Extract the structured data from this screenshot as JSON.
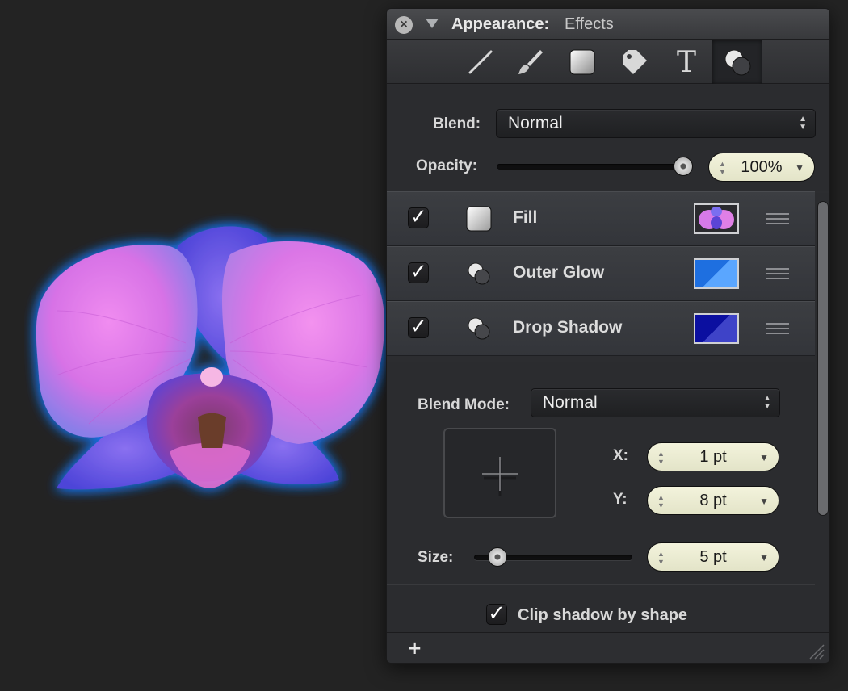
{
  "panel": {
    "title": "Appearance:",
    "subtitle": "Effects"
  },
  "toolbar": {
    "tools": [
      "line-tool-icon",
      "brush-tool-icon",
      "fill-tool-icon",
      "tag-tool-icon",
      "text-tool-icon",
      "effects-tool-icon"
    ],
    "text_glyph": "T",
    "active": "effects-tool-icon"
  },
  "blend": {
    "label": "Blend:",
    "value": "Normal"
  },
  "opacity": {
    "label": "Opacity:",
    "level": 1.0,
    "value": "100%"
  },
  "effects": [
    {
      "name": "Fill",
      "checked": true,
      "icon": "fill-square-icon",
      "swatch": "orchid-image-swatch"
    },
    {
      "name": "Outer Glow",
      "checked": true,
      "icon": "overlapping-circles-icon",
      "swatch_colors": [
        "#1e6fe0",
        "#5aa6ff"
      ]
    },
    {
      "name": "Drop Shadow",
      "checked": true,
      "icon": "overlapping-circles-icon",
      "swatch_colors": [
        "#0b0fa0",
        "#3e43c8"
      ]
    }
  ],
  "shadow": {
    "blend_mode_label": "Blend Mode:",
    "blend_mode_value": "Normal",
    "x_label": "X:",
    "x_value": "1 pt",
    "y_label": "Y:",
    "y_value": "8 pt",
    "size_label": "Size:",
    "size_value": "5 pt",
    "size_level": 0.1,
    "clip_label": "Clip shadow by shape",
    "clip_checked": true
  },
  "footer": {
    "add": "+"
  },
  "check_glyph": "✓",
  "colors": {
    "glow": "#1e6fe0",
    "shadow": "#0b0fa0",
    "stepper_bg": "#f0f0d8"
  }
}
